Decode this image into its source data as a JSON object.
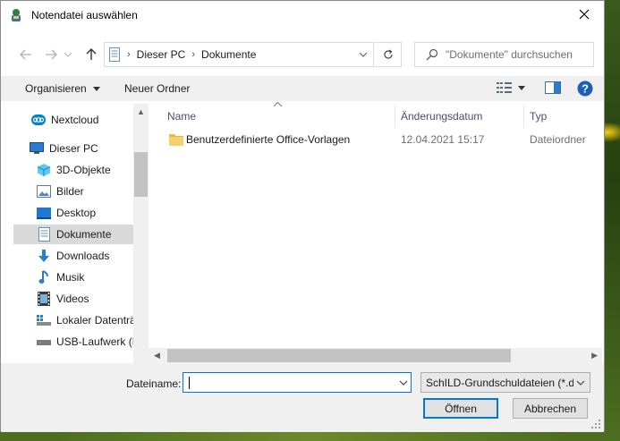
{
  "window": {
    "title": "Notendatei auswählen"
  },
  "address": {
    "crumbs": [
      "Dieser PC",
      "Dokumente"
    ]
  },
  "search": {
    "placeholder": "\"Dokumente\" durchsuchen"
  },
  "toolbar": {
    "organize": "Organisieren",
    "new_folder": "Neuer Ordner"
  },
  "sidebar": {
    "items": [
      {
        "label": "Nextcloud",
        "icon": "nextcloud-icon"
      },
      {
        "label": "Dieser PC",
        "icon": "computer-icon"
      },
      {
        "label": "3D-Objekte",
        "icon": "3d-objects-icon"
      },
      {
        "label": "Bilder",
        "icon": "pictures-icon"
      },
      {
        "label": "Desktop",
        "icon": "desktop-icon"
      },
      {
        "label": "Dokumente",
        "icon": "documents-icon"
      },
      {
        "label": "Downloads",
        "icon": "downloads-icon"
      },
      {
        "label": "Musik",
        "icon": "music-icon"
      },
      {
        "label": "Videos",
        "icon": "videos-icon"
      },
      {
        "label": "Lokaler Datenträ",
        "icon": "drive-icon"
      },
      {
        "label": "USB-Laufwerk (F",
        "icon": "usb-drive-icon"
      }
    ],
    "selected": "Dokumente"
  },
  "columns": {
    "name": "Name",
    "date": "Änderungsdatum",
    "type": "Typ"
  },
  "files": [
    {
      "name": "Benutzerdefinierte Office-Vorlagen",
      "date": "12.04.2021 15:17",
      "type": "Dateiordner"
    }
  ],
  "footer": {
    "filename_label": "Dateiname:",
    "filename_value": "",
    "filter_value": "SchILD-Grundschuldateien (*.d",
    "open_label": "Öffnen",
    "cancel_label": "Abbrechen"
  },
  "colors": {
    "accent": "#0078d7",
    "help": "#1a5fb4",
    "folder": "#f6d36a"
  }
}
